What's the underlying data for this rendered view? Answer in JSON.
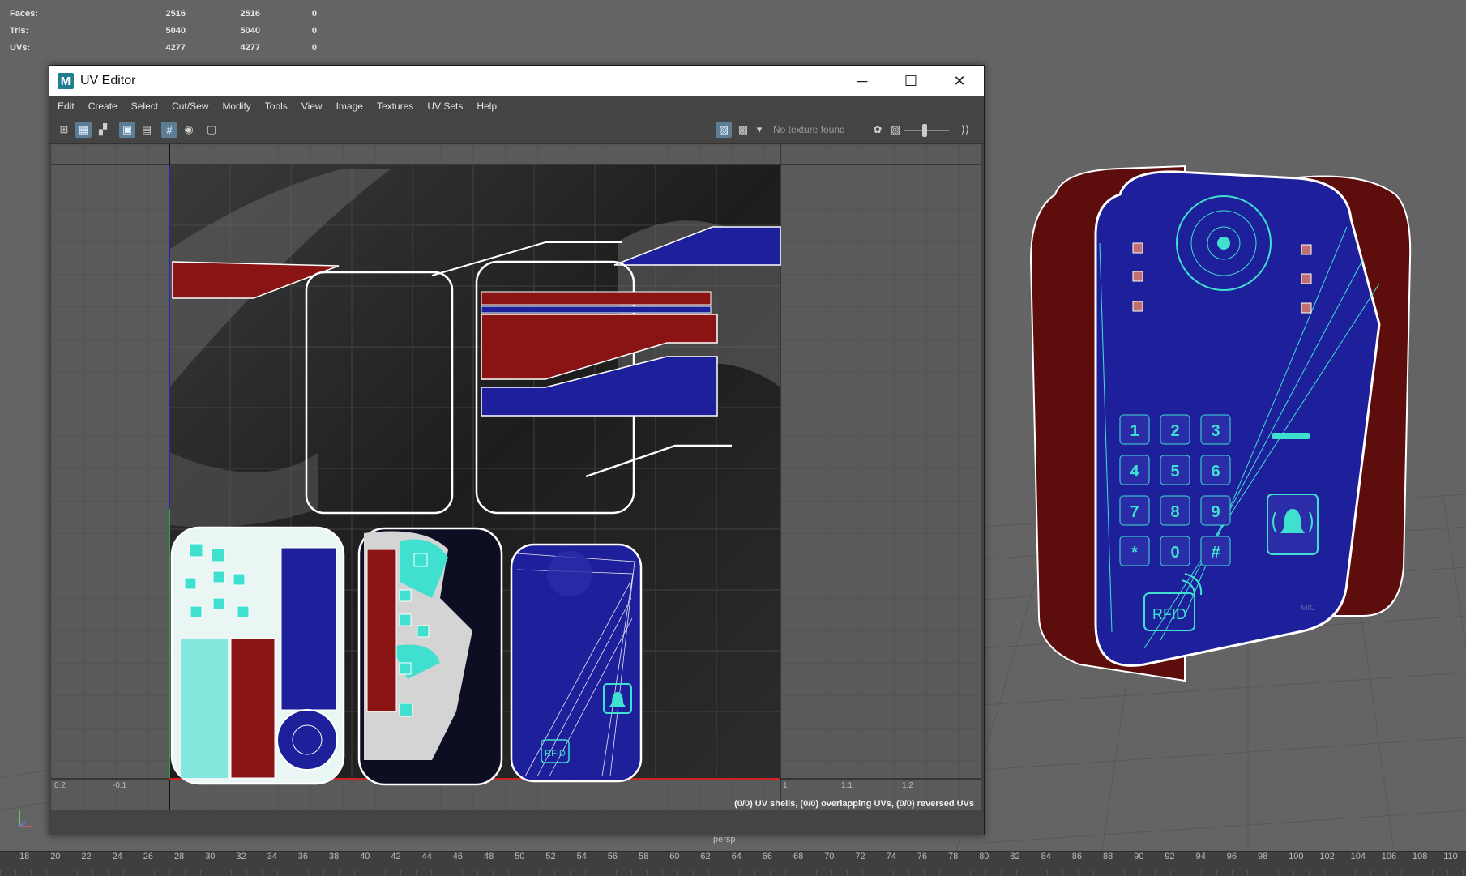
{
  "hud": {
    "rows": [
      {
        "label": "Faces:",
        "a": "2516",
        "b": "2516",
        "c": "0"
      },
      {
        "label": "Tris:",
        "a": "5040",
        "b": "5040",
        "c": "0"
      },
      {
        "label": "UVs:",
        "a": "4277",
        "b": "4277",
        "c": "0"
      }
    ]
  },
  "window": {
    "title": "UV Editor",
    "logo": "M",
    "minimize_icon": "─",
    "maximize_icon": "☐",
    "close_icon": "✕"
  },
  "menu": [
    "Edit",
    "Create",
    "Select",
    "Cut/Sew",
    "Modify",
    "Tools",
    "View",
    "Image",
    "Textures",
    "UV Sets",
    "Help"
  ],
  "toolbar": {
    "no_texture": "No texture found",
    "slider_level": 0.45,
    "icons": [
      "grid-shell-icon",
      "uv-shell-icon",
      "checker-icon",
      "frame-icon",
      "distortion-icon",
      "grid-toggle-icon",
      "isolate-icon",
      "snapshot-icon",
      "image-display-icon",
      "checker-display-icon",
      "dropdown-icon",
      "texture-filter-icon",
      "image-icon",
      "exposure-slider",
      "arrows-icon"
    ]
  },
  "status": {
    "text": "(0/0) UV shells, (0/0) overlapping UVs, (0/0) reversed UVs"
  },
  "uv_axis": {
    "labels": [
      "0.2",
      "-0.1",
      "1",
      "1.1",
      "1.2"
    ]
  },
  "viewport": {
    "camera_label": "persp"
  },
  "timeline": {
    "ticks": [
      "18",
      "20",
      "22",
      "24",
      "26",
      "28",
      "30",
      "32",
      "34",
      "36",
      "38",
      "40",
      "42",
      "44",
      "46",
      "48",
      "50",
      "52",
      "54",
      "56",
      "58",
      "60",
      "62",
      "64",
      "66",
      "68",
      "70",
      "72",
      "74",
      "76",
      "78",
      "80",
      "82",
      "84",
      "86",
      "88",
      "90",
      "92",
      "94",
      "96",
      "98",
      "100",
      "102",
      "104",
      "106",
      "108",
      "110"
    ]
  },
  "device": {
    "keys": [
      "1",
      "2",
      "3",
      "4",
      "5",
      "6",
      "7",
      "8",
      "9",
      "*",
      "0",
      "#"
    ],
    "rfid_label": "RFID",
    "mic_label": "MIC",
    "uv_rfid_label": "RFID"
  },
  "colors": {
    "blue": "#1e1f9a",
    "red": "#8a1414",
    "cyan": "#3fe0d0",
    "grey_bg": "#646464"
  }
}
